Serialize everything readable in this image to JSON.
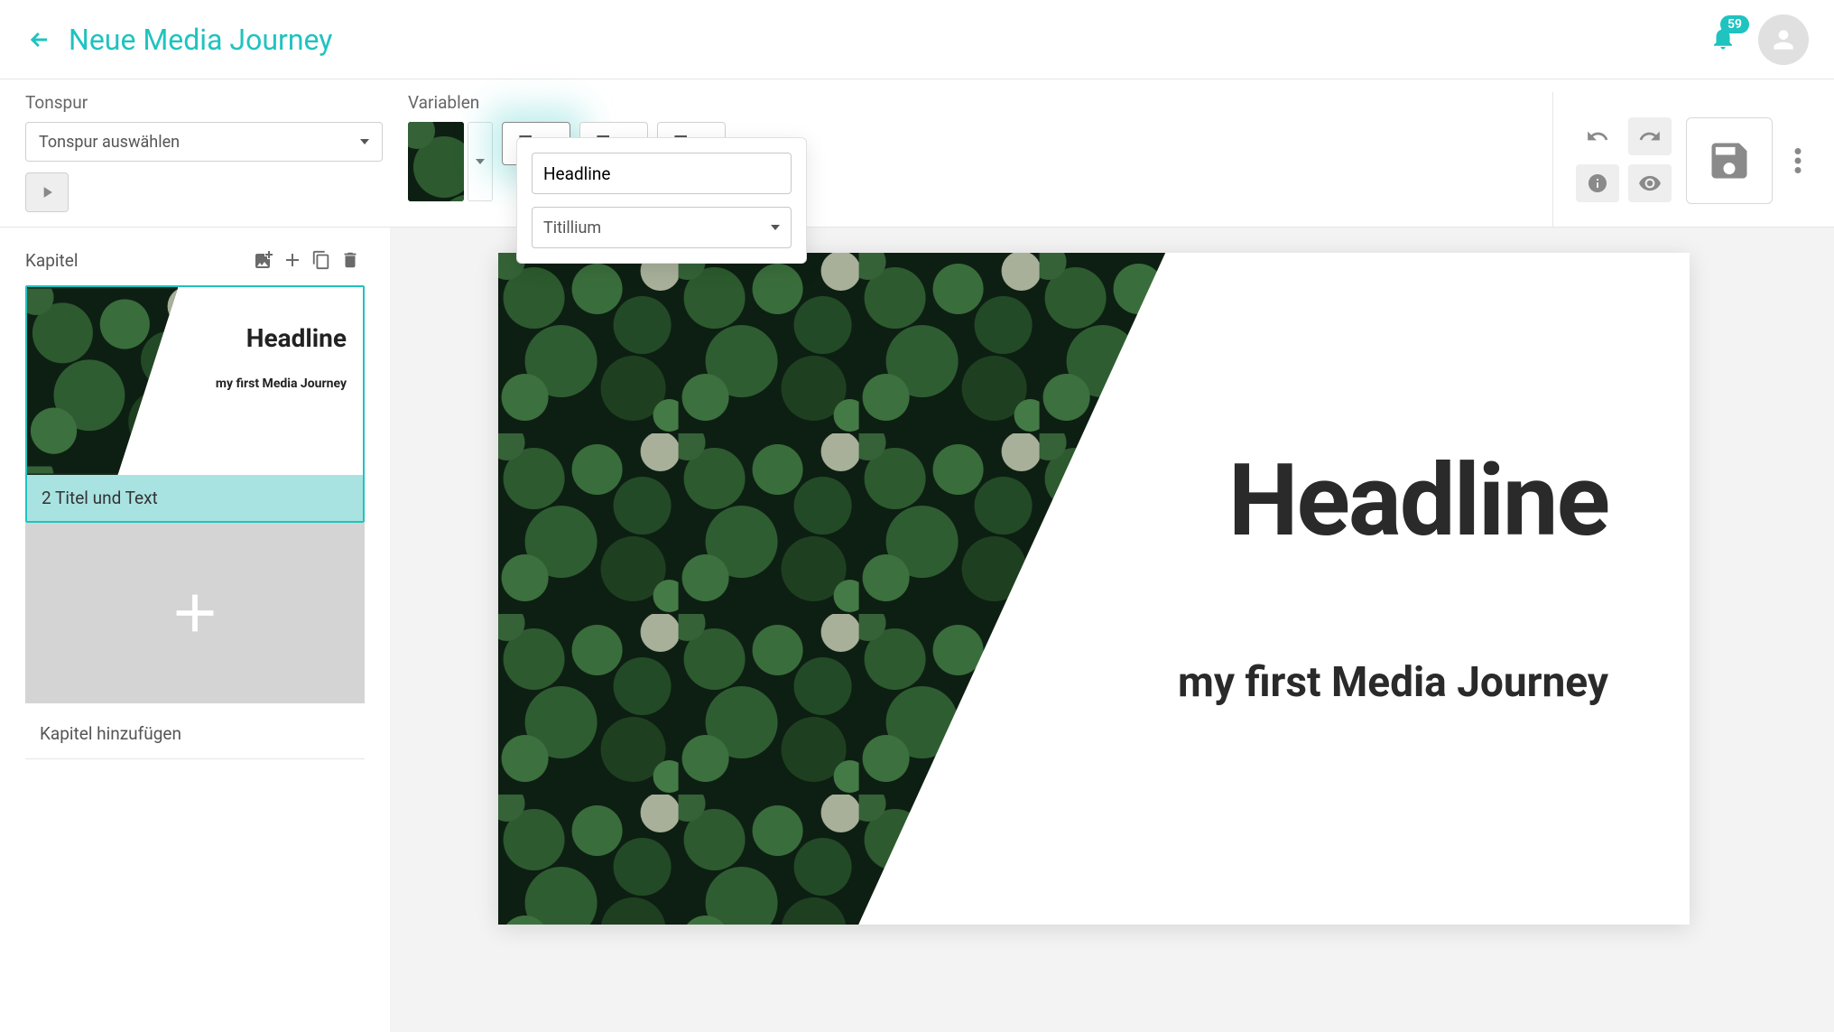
{
  "header": {
    "title": "Neue Media Journey",
    "notification_count": "59"
  },
  "tonspur": {
    "label": "Tonspur",
    "placeholder": "Tonspur auswählen"
  },
  "variablen": {
    "label": "Variablen",
    "headline_input": "Headline",
    "font_select": "Titillium"
  },
  "kapitel": {
    "label": "Kapitel",
    "add_chapter": "Kapitel hinzufügen",
    "slides": [
      {
        "headline": "Headline",
        "subtitle": "my first Media Journey",
        "caption": "2 Titel und Text"
      }
    ]
  },
  "canvas": {
    "headline": "Headline",
    "subtitle": "my first Media Journey"
  }
}
